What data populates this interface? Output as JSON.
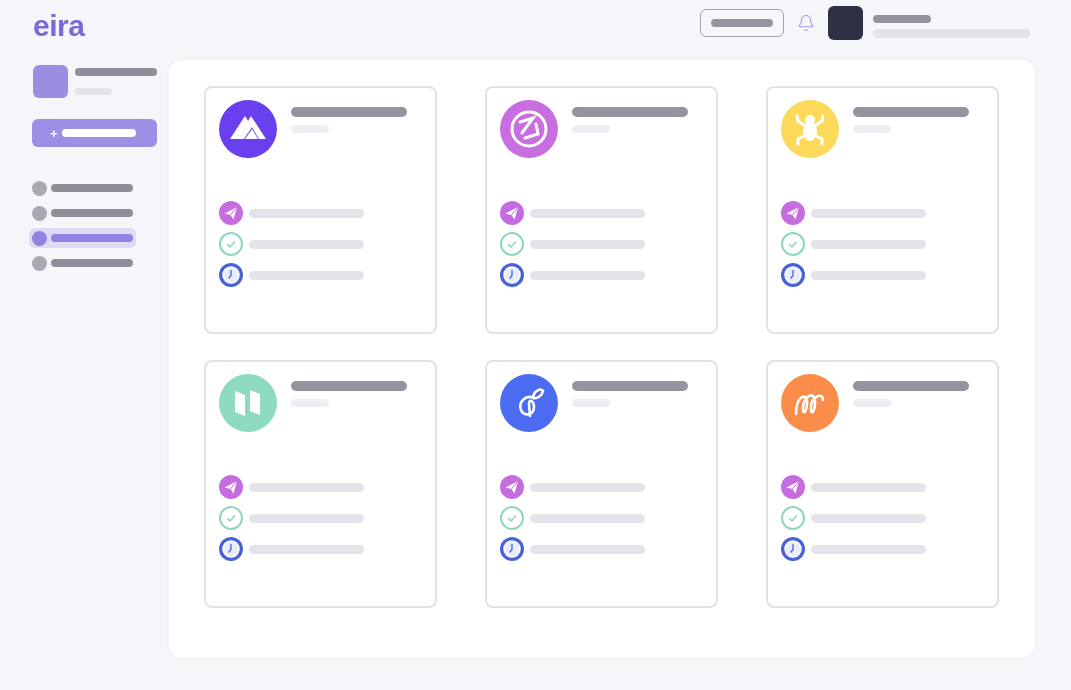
{
  "logo": {
    "text": "eira"
  },
  "sidebar": {
    "new_button": {
      "label": "+"
    },
    "nav_items": [
      {
        "selected": false
      },
      {
        "selected": false
      },
      {
        "selected": true
      },
      {
        "selected": false
      }
    ]
  },
  "cards": [
    {
      "kind": "peak",
      "color": "#6a3ff0"
    },
    {
      "kind": "ring",
      "color": "#c86ee0"
    },
    {
      "kind": "frog",
      "color": "#fcd95a"
    },
    {
      "kind": "blocks",
      "color": "#8fdbc2"
    },
    {
      "kind": "sprout",
      "color": "#4b6cf0"
    },
    {
      "kind": "coil",
      "color": "#fb8d4b"
    }
  ]
}
